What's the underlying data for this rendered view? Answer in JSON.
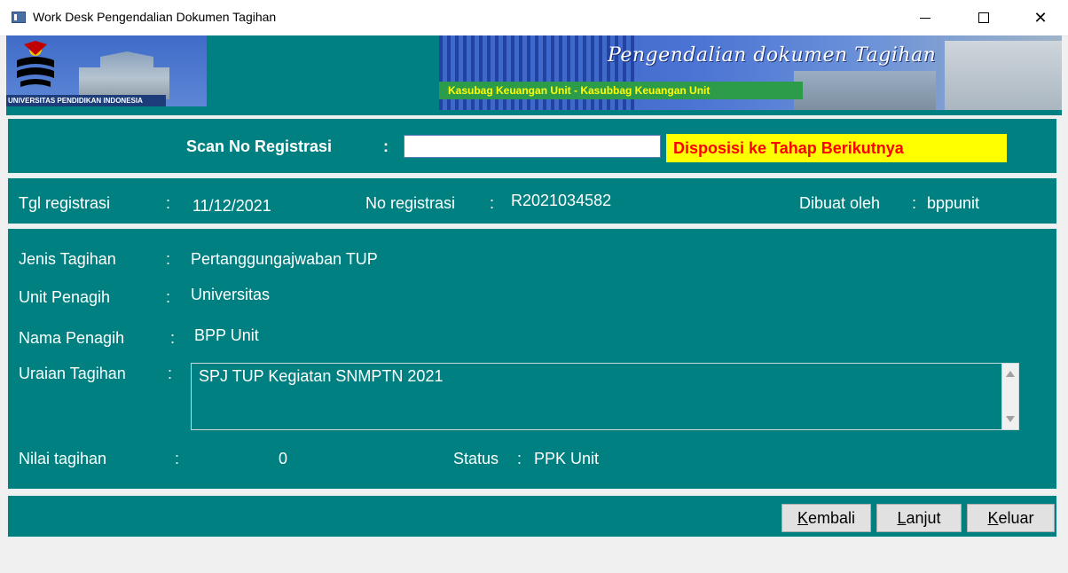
{
  "window": {
    "title": "Work Desk Pengendalian Dokumen Tagihan",
    "minimize_glyph": "—",
    "maximize_glyph": "☐",
    "close_glyph": "✕"
  },
  "banner": {
    "logo_caption": "UNIVERSITAS PENDIDIKAN INDONESIA",
    "heading": "Pengendalian dokumen Tagihan",
    "subtitle": "Kasubag Keuangan Unit - Kasubbag Keuangan Unit"
  },
  "scan": {
    "label": "Scan No Registrasi",
    "colon": ":",
    "input_value": "",
    "disposisi_label": "Disposisi ke Tahap Berikutnya"
  },
  "info": {
    "tgl_label": "Tgl registrasi",
    "tgl_colon": ":",
    "tgl_value": "11/12/2021",
    "no_label": "No registrasi",
    "no_colon": ":",
    "no_value": "R2021034582",
    "dibuat_label": "Dibuat oleh",
    "dibuat_colon": ":",
    "dibuat_value": "bppunit"
  },
  "detail": {
    "jenis_label": "Jenis Tagihan",
    "jenis_colon": ":",
    "jenis_value": "Pertanggungajwaban TUP",
    "unit_label": "Unit Penagih",
    "unit_colon": ":",
    "unit_value": "Universitas",
    "nama_label": "Nama Penagih",
    "nama_colon": ":",
    "nama_value": "BPP Unit",
    "uraian_label": "Uraian Tagihan",
    "uraian_colon": ":",
    "uraian_value": "SPJ TUP Kegiatan SNMPTN 2021",
    "nilai_label": "Nilai tagihan",
    "nilai_colon": ":",
    "nilai_value": "0",
    "status_label": "Status",
    "status_colon": ":",
    "status_value": "PPK Unit"
  },
  "buttons": {
    "kembali_first": "K",
    "kembali_rest": "embali",
    "lanjut_first": "L",
    "lanjut_rest": "anjut",
    "keluar_first": "K",
    "keluar_rest": "eluar"
  },
  "colors": {
    "panel_bg": "#008080",
    "disposisi_bg": "#ffff00",
    "disposisi_text": "#ff0000",
    "banner_sub_text": "#ffff00"
  }
}
